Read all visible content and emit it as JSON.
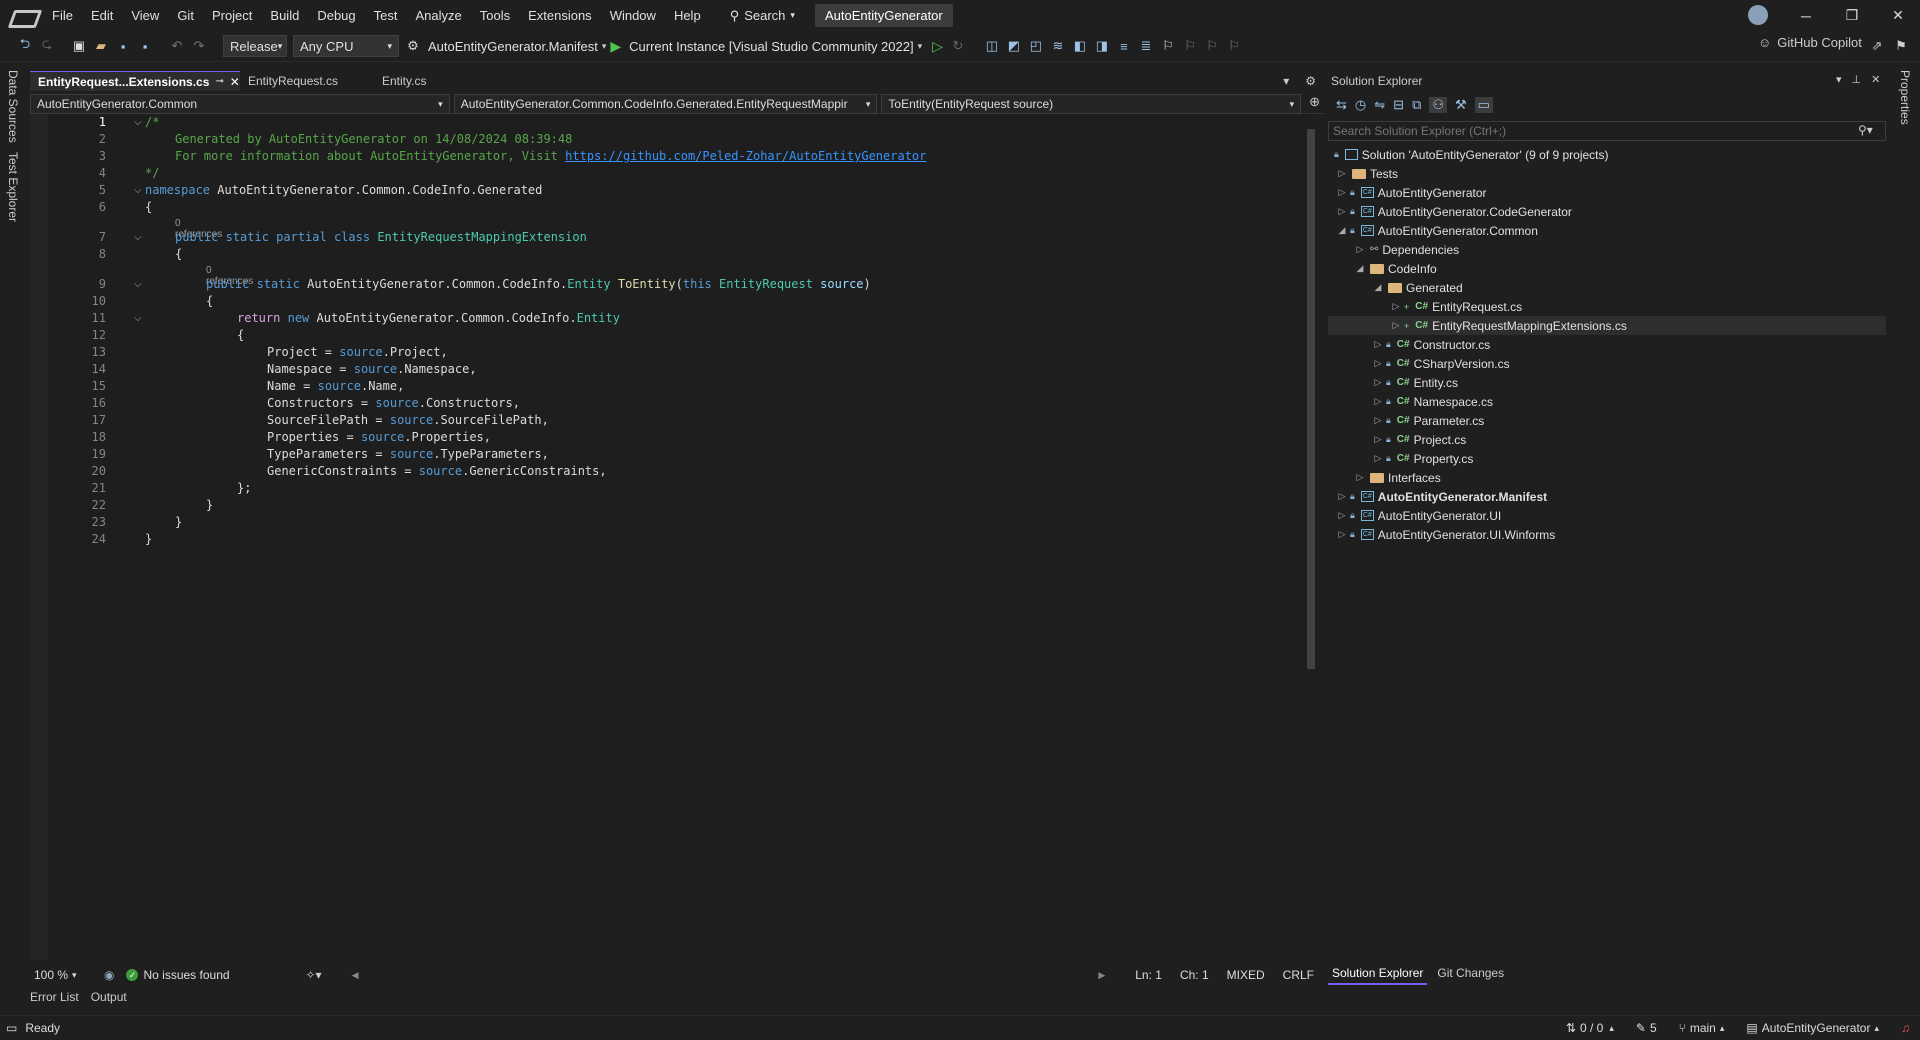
{
  "menubar": {
    "items": [
      "File",
      "Edit",
      "View",
      "Git",
      "Project",
      "Build",
      "Debug",
      "Test",
      "Analyze",
      "Tools",
      "Extensions",
      "Window",
      "Help"
    ],
    "search_label": "Search",
    "solution_name": "AutoEntityGenerator"
  },
  "toolbar": {
    "configuration": "Release",
    "platform": "Any CPU",
    "startup_project": "AutoEntityGenerator.Manifest",
    "run_target": "Current Instance [Visual Studio Community 2022]",
    "copilot": "GitHub Copilot"
  },
  "side": {
    "left_tabs": [
      "Data Sources",
      "Test Explorer"
    ],
    "right_tabs": [
      "Properties"
    ]
  },
  "editor": {
    "tabs": [
      {
        "label": "EntityRequest...Extensions.cs",
        "active": true
      },
      {
        "label": "EntityRequest.cs",
        "active": false
      },
      {
        "label": "Entity.cs",
        "active": false
      }
    ],
    "nav": {
      "project": "AutoEntityGenerator.Common",
      "type": "AutoEntityGenerator.Common.CodeInfo.Generated.EntityRequestMappir",
      "member": "ToEntity(EntityRequest source)"
    },
    "refs_label": "0 references",
    "header": {
      "line1": "Generated by AutoEntityGenerator on 14/08/2024 08:39:48",
      "line2_prefix": "For more information about AutoEntityGenerator, Visit ",
      "url": "https://github.com/Peled-Zohar/AutoEntityGenerator"
    },
    "namespace": "AutoEntityGenerator.Common.CodeInfo.Generated",
    "class_name": "EntityRequestMappingExtension",
    "entity_ns": "AutoEntityGenerator.Common.CodeInfo.",
    "entity": "Entity",
    "method": "ToEntity",
    "param_type": "EntityRequest",
    "param": "source",
    "properties": [
      "Project",
      "Namespace",
      "Name",
      "Constructors",
      "SourceFilePath",
      "Properties",
      "TypeParameters",
      "GenericConstraints"
    ],
    "zoom": "100 %",
    "issues": "No issues found",
    "ln": "Ln: 1",
    "ch": "Ch: 1",
    "whitespace": "MIXED",
    "eol": "CRLF",
    "bottom_tabs": [
      "Error List",
      "Output"
    ]
  },
  "solution_explorer": {
    "title": "Solution Explorer",
    "search_placeholder": "Search Solution Explorer (Ctrl+;)",
    "solution": "Solution 'AutoEntityGenerator' (9 of 9 projects)",
    "tree": [
      {
        "label": "Tests",
        "kind": "folder",
        "depth": 0,
        "exp": "▷"
      },
      {
        "label": "AutoEntityGenerator",
        "kind": "proj",
        "depth": 0,
        "exp": "▷"
      },
      {
        "label": "AutoEntityGenerator.CodeGenerator",
        "kind": "proj",
        "depth": 0,
        "exp": "▷"
      },
      {
        "label": "AutoEntityGenerator.Common",
        "kind": "proj",
        "depth": 0,
        "exp": "◢"
      },
      {
        "label": "Dependencies",
        "kind": "dep",
        "depth": 1,
        "exp": "▷"
      },
      {
        "label": "CodeInfo",
        "kind": "folder",
        "depth": 1,
        "exp": "◢"
      },
      {
        "label": "Generated",
        "kind": "folder",
        "depth": 2,
        "exp": "◢"
      },
      {
        "label": "EntityRequest.cs",
        "kind": "cs",
        "depth": 3,
        "exp": "▷"
      },
      {
        "label": "EntityRequestMappingExtensions.cs",
        "kind": "cs",
        "depth": 3,
        "exp": "▷",
        "selected": true
      },
      {
        "label": "Constructor.cs",
        "kind": "cs",
        "depth": 2,
        "exp": "▷"
      },
      {
        "label": "CSharpVersion.cs",
        "kind": "cs",
        "depth": 2,
        "exp": "▷"
      },
      {
        "label": "Entity.cs",
        "kind": "cs",
        "depth": 2,
        "exp": "▷"
      },
      {
        "label": "Namespace.cs",
        "kind": "cs",
        "depth": 2,
        "exp": "▷"
      },
      {
        "label": "Parameter.cs",
        "kind": "cs",
        "depth": 2,
        "exp": "▷"
      },
      {
        "label": "Project.cs",
        "kind": "cs",
        "depth": 2,
        "exp": "▷"
      },
      {
        "label": "Property.cs",
        "kind": "cs",
        "depth": 2,
        "exp": "▷"
      },
      {
        "label": "Interfaces",
        "kind": "folder",
        "depth": 1,
        "exp": "▷"
      },
      {
        "label": "AutoEntityGenerator.Manifest",
        "kind": "proj",
        "depth": 0,
        "exp": "▷",
        "bold": true
      },
      {
        "label": "AutoEntityGenerator.UI",
        "kind": "proj",
        "depth": 0,
        "exp": "▷"
      },
      {
        "label": "AutoEntityGenerator.UI.Winforms",
        "kind": "proj",
        "depth": 0,
        "exp": "▷"
      }
    ],
    "bottom_tabs": [
      "Solution Explorer",
      "Git Changes"
    ]
  },
  "statusbar": {
    "ready": "Ready",
    "commits": "0 / 0",
    "changes": "5",
    "branch": "main",
    "repo": "AutoEntityGenerator"
  }
}
